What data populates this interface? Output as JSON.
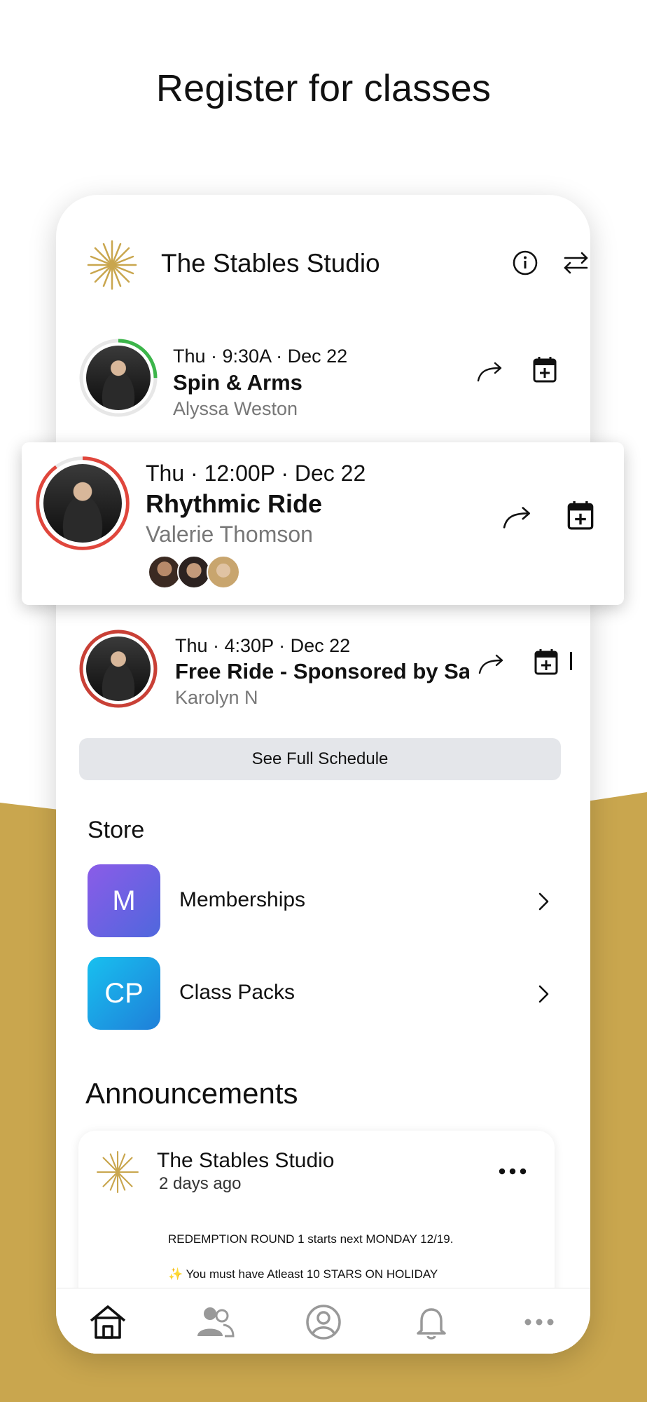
{
  "headline": "Register for classes",
  "studio": {
    "name": "The Stables Studio"
  },
  "classes": [
    {
      "when": "Thu · 9:30A · Dec 22",
      "title": "Spin & Arms",
      "instructor": "Alyssa Weston",
      "ring_color": "#3cb54a",
      "ring_fill": 0.25
    },
    {
      "when": "Thu · 12:00P · Dec 22",
      "title": "Rhythmic Ride",
      "instructor": "Valerie Thomson",
      "ring_color": "#e0463c",
      "ring_fill": 0.9
    },
    {
      "when": "Thu · 4:30P · Dec 22",
      "title": "Free Ride - Sponsored by Sa",
      "instructor": "Karolyn  N",
      "ring_color": "#c94036",
      "ring_fill": 1.0
    }
  ],
  "schedule_button": "See Full Schedule",
  "store": {
    "title": "Store",
    "items": [
      {
        "badge": "M",
        "label": "Memberships"
      },
      {
        "badge": "CP",
        "label": "Class Packs"
      }
    ]
  },
  "announcements": {
    "title": "Announcements",
    "post": {
      "author": "The Stables Studio",
      "time": "2 days ago",
      "line1": "REDEMPTION ROUND 1 starts next MONDAY 12/19.",
      "line2": "✨ You must have Atleast 10 STARS ON HOLIDAY"
    }
  },
  "tabs": [
    "home-icon",
    "people-icon",
    "profile-icon",
    "bell-icon",
    "more-icon"
  ]
}
